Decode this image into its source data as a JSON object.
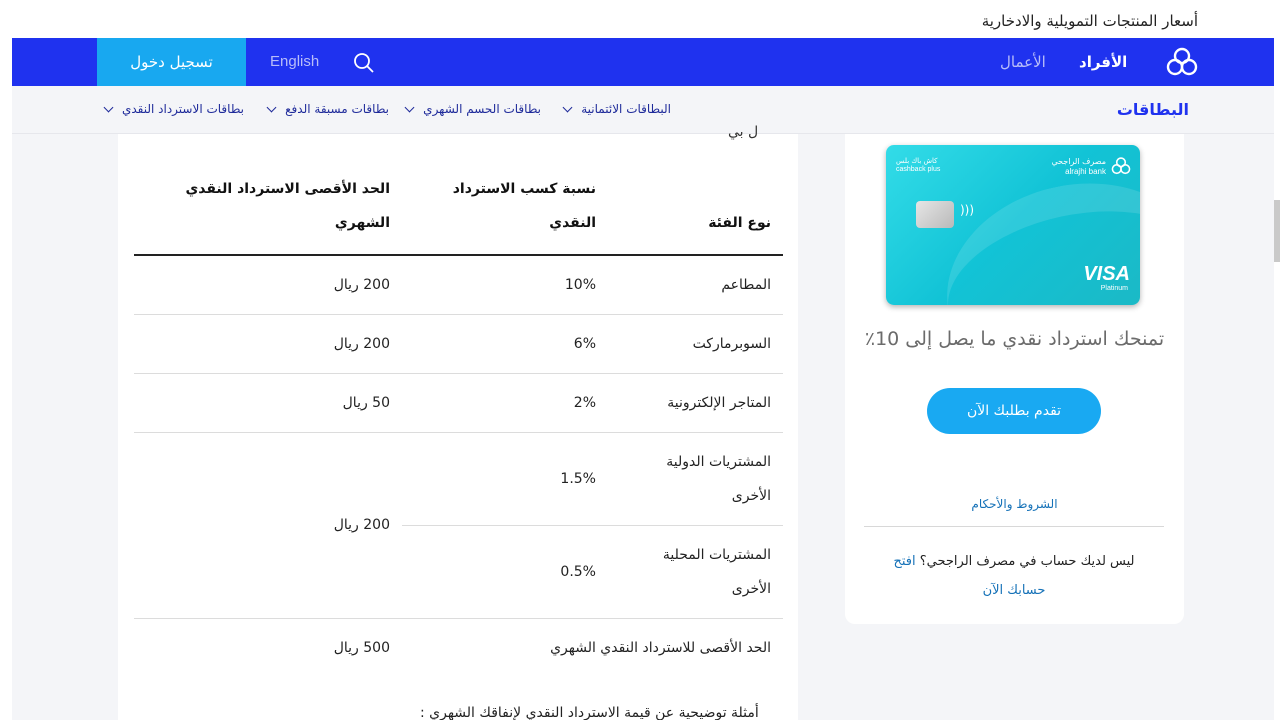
{
  "top_link": "أسعار المنتجات التمويلية والادخارية",
  "nav": {
    "login": "تسجيل دخول",
    "language": "English",
    "business": "الأعمال",
    "individuals": "الأفراد"
  },
  "subnav": {
    "title": "البطاقات",
    "items": [
      "البطاقات الائتمانية",
      "بطاقات الحسم الشهري",
      "بطاقات مسبقة الدفع",
      "بطاقات الاسترداد النقدي"
    ]
  },
  "truncated_text": "ل بي",
  "table": {
    "headers": {
      "category": "نوع الفئة",
      "rate_line1": "نسبة كسب الاسترداد",
      "rate_line2": "النقدي",
      "cap_line1": "الحد الأقصى الاسترداد النقدي",
      "cap_line2": "الشهري"
    },
    "rows": [
      {
        "category": "المطاعم",
        "rate": "10%",
        "cap": "200 ريال"
      },
      {
        "category": "السوبرماركت",
        "rate": "6%",
        "cap": "200 ريال"
      },
      {
        "category": "المتاجر الإلكترونية",
        "rate": "2%",
        "cap": "50 ريال"
      },
      {
        "category_line1": "المشتريات الدولية",
        "category_line2": "الأخرى",
        "rate": "1.5%"
      },
      {
        "category_line1": "المشتريات المحلية",
        "category_line2": "الأخرى",
        "rate": "0.5%"
      },
      {
        "category": "الحد الأقصى للاسترداد النقدي الشهري",
        "cap": "500 ريال"
      }
    ],
    "merged_cap": "200 ريال"
  },
  "bottom_note": "أمثلة توضيحية عن قيمة الاسترداد النقدي لإنفاقك الشهري :",
  "card": {
    "brand_ar": "مصرف الراجحي",
    "brand_en": "alrajhi bank",
    "cashback_ar": "كاش باك بلس",
    "cashback_en": "cashback plus",
    "network": "VISA",
    "tier": "Platinum"
  },
  "side": {
    "offer": "تمنحك استرداد نقدي ما يصل إلى 10٪",
    "apply": "تقدم بطلبك الآن",
    "terms": "الشروط والأحكام",
    "no_account": "ليس لديك حساب في مصرف الراجحي؟",
    "open_link_1": "افتح",
    "open_link_2": "حسابك الآن"
  },
  "colors": {
    "nav_bg": "#1f32ef",
    "login_bg": "#18a8f0",
    "button_bg": "#19a9f2",
    "link": "#1672b8"
  }
}
